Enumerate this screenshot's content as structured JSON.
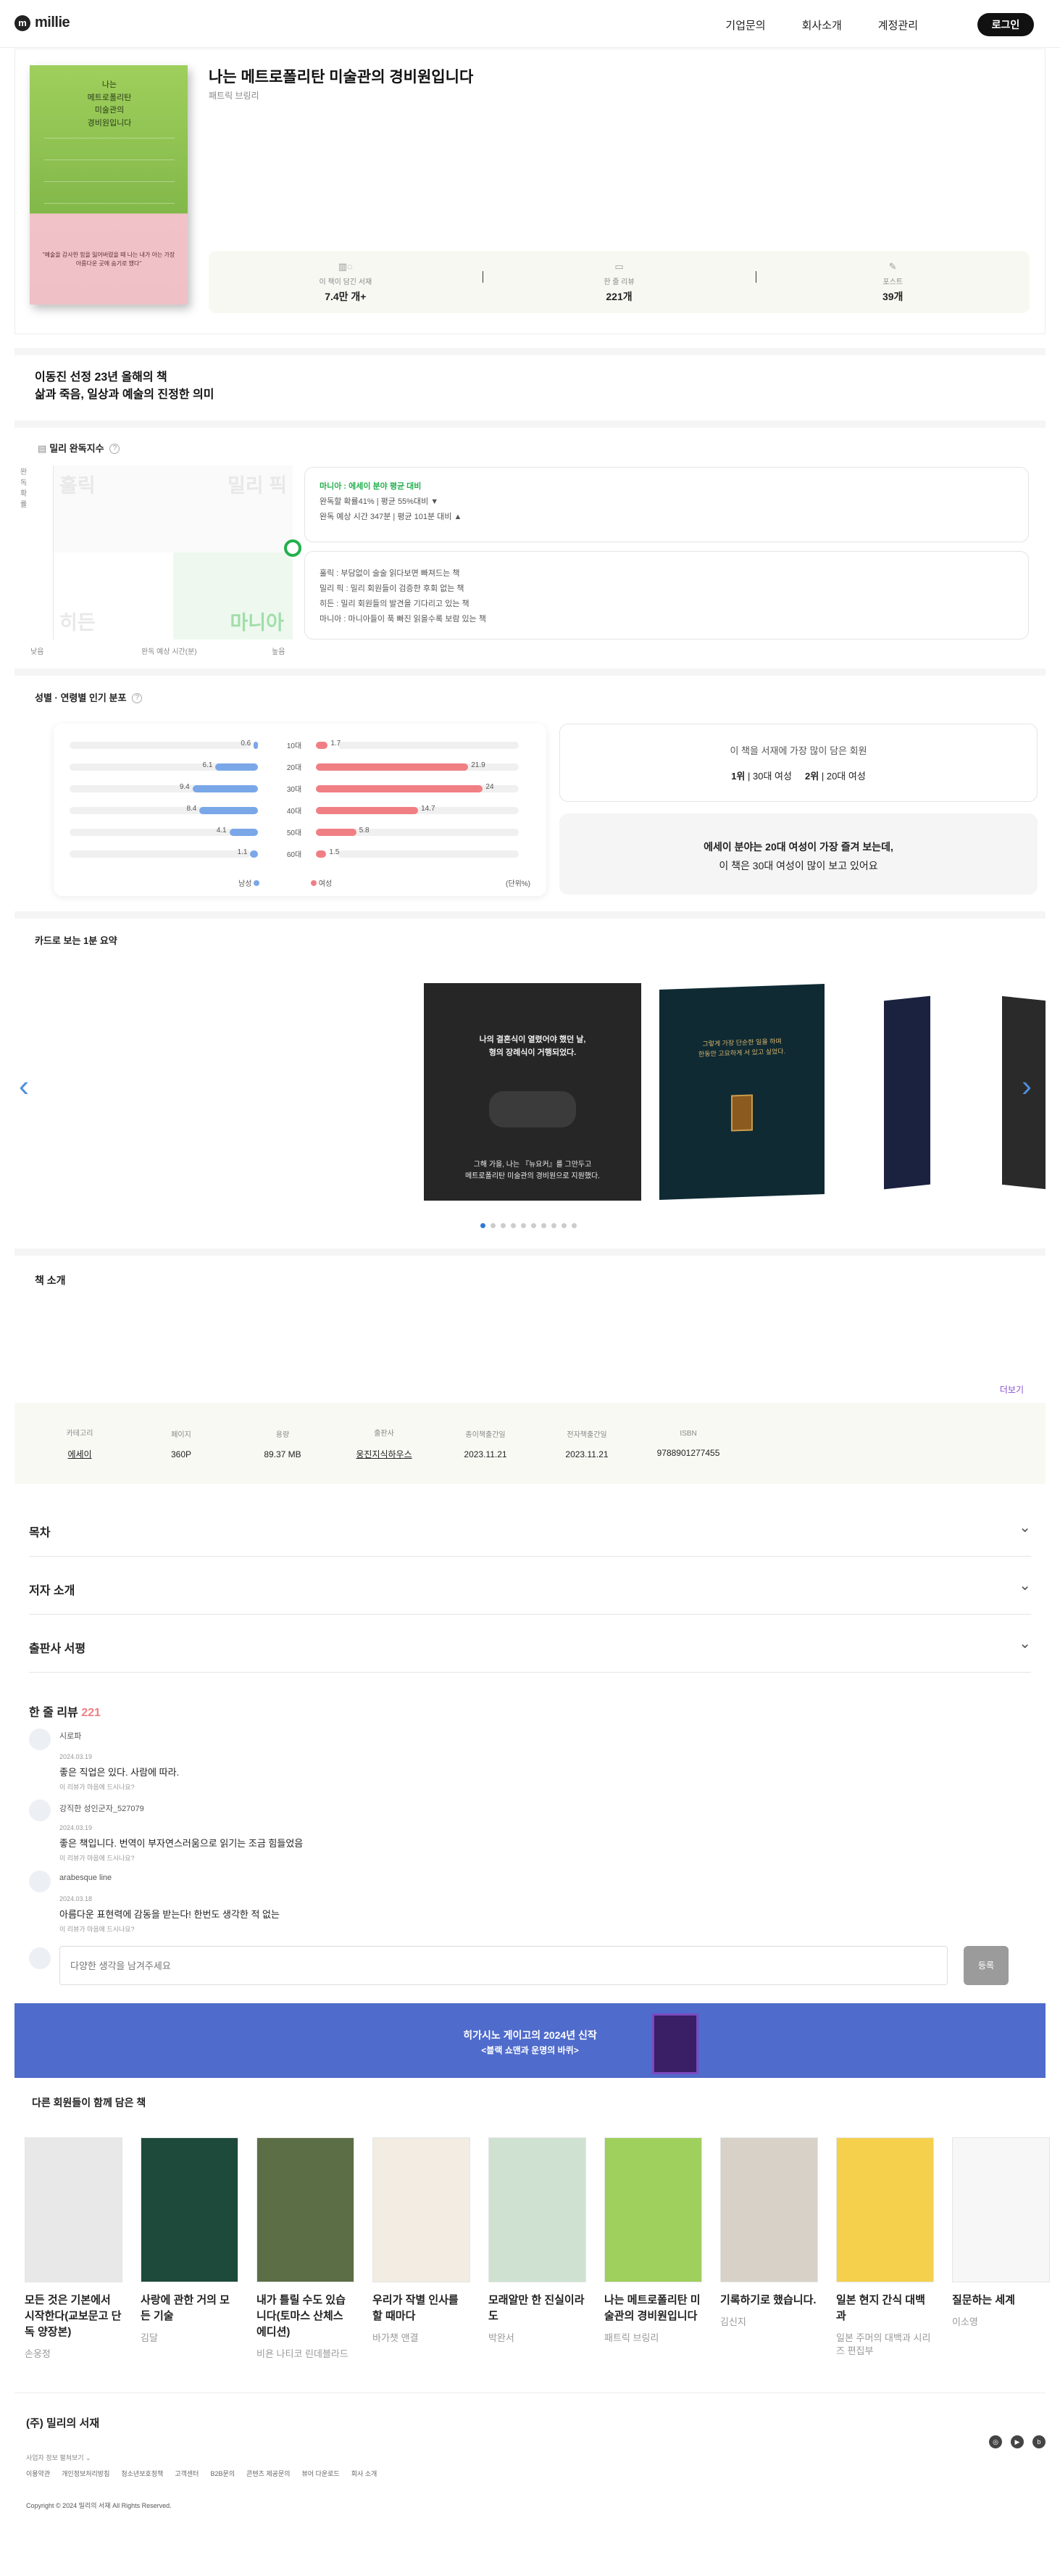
{
  "header": {
    "logo": "millie",
    "menu": [
      "기업문의",
      "회사소개",
      "계정관리"
    ],
    "login": "로그인"
  },
  "book": {
    "title": "나는 메트로폴리탄 미술관의 경비원입니다",
    "author": "패트릭 브링리",
    "cover": {
      "title_lines": [
        "나는",
        "메트로폴리탄",
        "미술관의",
        "경비원입니다"
      ],
      "quote": "\"예술을 감사한 힘을 잃어버렸을 때 나는 내가 아는 가장 아름다운 곳에 숨기로 했다\""
    },
    "stats": [
      {
        "icon": "bookshelf-icon",
        "label": "이 책이 담긴 서재",
        "value": "7.4만 개+"
      },
      {
        "icon": "one-line-review-icon",
        "label": "한 줄 리뷰",
        "value": "221개"
      },
      {
        "icon": "post-icon",
        "label": "포스트",
        "value": "39개"
      }
    ]
  },
  "tagline": [
    "이동진 선정 23년 올해의 책",
    "삶과 죽음, 일상과 예술의 진정한 의미"
  ],
  "index": {
    "title": "밀리 완독지수",
    "quadrants": [
      "훌릭",
      "밀리 픽",
      "히든",
      "마니아"
    ],
    "axis_y": "완독 확률",
    "axis_x": "완독 예상 시간(분)",
    "low": "낮음",
    "high": "높음",
    "summary_title": "마니아 : 에세이 분야 평균 대비",
    "summary_lines": [
      "완독할 확률41% | 평균 55%대비 ▼",
      "완독 예상 시간 347분 | 평균 101분 대비 ▲"
    ],
    "legend": [
      {
        "k": "훌릭",
        "v": "부담없이 술술 읽다보면 빠져드는 책"
      },
      {
        "k": "밀리 픽",
        "v": "밀리 회원들이 검증한 후회 없는 책"
      },
      {
        "k": "히든",
        "v": "밀리 회원들의 발견을 기다리고 있는 책"
      },
      {
        "k": "마니아",
        "v": "마니아들이 푹 빠진 읽을수록 보람 있는 책"
      }
    ]
  },
  "gender": {
    "title": "성별 · 연령별 인기 분포",
    "unit": "(단위%)",
    "male_label": "남성",
    "female_label": "여성",
    "rows": [
      {
        "age": "10대",
        "male": "0.6",
        "female": "1.7"
      },
      {
        "age": "20대",
        "male": "6.1",
        "female": "21.9"
      },
      {
        "age": "30대",
        "male": "9.4",
        "female": "24"
      },
      {
        "age": "40대",
        "male": "8.4",
        "female": "14.7"
      },
      {
        "age": "50대",
        "male": "4.1",
        "female": "5.8"
      },
      {
        "age": "60대",
        "male": "1.1",
        "female": "1.5"
      }
    ],
    "top_title": "이 책을 서재에 가장 많이 담은 회원",
    "top_1": "1위",
    "top_1_val": "30대 여성",
    "top_2": "2위",
    "top_2_val": "20대 여성",
    "note_1": "에세이 분야는 20대 여성이 가장 즐겨 보는데,",
    "note_2": "이 책은 30대 여성이 많이 보고 있어요"
  },
  "cards": {
    "title": "카드로 보는 1분 요약",
    "card1_top": [
      "나의 결혼식이 열렸어야 했던 날,",
      "형의 장례식이 거행되었다."
    ],
    "card1_bottom": [
      "그해 가을, 나는 『뉴요커』를 그만두고",
      "메트로폴리탄 미술관의 경비원으로 지원했다."
    ],
    "card2_text": [
      "그렇게 가장 단순한 일을 하며",
      "한동안 고요하게 서 있고 싶었다."
    ]
  },
  "intro": {
    "title": "책 소개",
    "more": "더보기"
  },
  "meta": [
    {
      "label": "카테고리",
      "value": "에세이"
    },
    {
      "label": "페이지",
      "value": "360P"
    },
    {
      "label": "용량",
      "value": "89.37 MB"
    },
    {
      "label": "출판사",
      "value": "웅진지식하우스"
    },
    {
      "label": "종이책출간일",
      "value": "2023.11.21"
    },
    {
      "label": "전자책출간일",
      "value": "2023.11.21"
    },
    {
      "label": "ISBN",
      "value": "9788901277455"
    }
  ],
  "accordions": [
    "목차",
    "저자 소개",
    "출판사 서평"
  ],
  "reviews": {
    "title": "한 줄 리뷰",
    "count": "221",
    "help": "이 리뷰가 마음에 드시나요?",
    "placeholder": "다양한 생각을 남겨주세요",
    "submit": "등록",
    "items": [
      {
        "name": "시로파",
        "date": "2024.03.19",
        "text": "좋은 직업은 있다. 사람에 따라."
      },
      {
        "name": "강직한 성인군자_527079",
        "date": "2024.03.19",
        "text": "좋은 책입니다. 번역이 부자연스러움으로 읽기는 조금 힘들었음"
      },
      {
        "name": "arabesque line",
        "date": "2024.03.18",
        "text": "아름다운 표현력에 감동을 받는다! 한번도 생각한 적 없는"
      }
    ]
  },
  "banner": {
    "line1": "히가시노 게이고의 2024년 신작",
    "line2": "<블랙 쇼맨과 운명의 바퀴>"
  },
  "recs": {
    "title": "다른 회원들이 함께 담은 책",
    "books": [
      {
        "title": "모든 것은 기본에서 시작한다(교보문고 단독 양장본)",
        "author": "손웅정",
        "color": "#e8e8e8"
      },
      {
        "title": "사랑에 관한 거의 모든 기술",
        "author": "김달",
        "color": "#1d4a3a"
      },
      {
        "title": "내가 틀릴 수도 있습니다(토마스 산체스 에디션)",
        "author": "비욘 나티코 린데블라드",
        "color": "#5b6e45"
      },
      {
        "title": "우리가 작별 인사를 할 때마다",
        "author": "바가챗 앤결",
        "color": "#f2ece2"
      },
      {
        "title": "모래알만 한 진실이라도",
        "author": "박완서",
        "color": "#cfe2d2"
      },
      {
        "title": "나는 메트로폴리탄 미술관의 경비원입니다",
        "author": "패트릭 브링리",
        "color": "#9fcf5c"
      },
      {
        "title": "기록하기로 했습니다.",
        "author": "김신지",
        "color": "#d7d1c8"
      },
      {
        "title": "일본 현지 간식 대백과",
        "author": "일본 주머의 대백과 시리즈 편집부",
        "color": "#f4d04d"
      },
      {
        "title": "질문하는 세계",
        "author": "이소영",
        "color": "#f7f7f7"
      }
    ]
  },
  "footer": {
    "company": "(주) 밀리의 서재",
    "info_toggle": "사업자 정보 펼쳐보기",
    "links": [
      "이용약관",
      "개인정보처리방침",
      "청소년보호정책",
      "고객센터",
      "B2B문의",
      "콘텐츠 제공문의",
      "뷰어 다운로드",
      "회사 소개"
    ],
    "copyright": "Copyright © 2024 밀리의 서재 All Rights Reserved."
  }
}
